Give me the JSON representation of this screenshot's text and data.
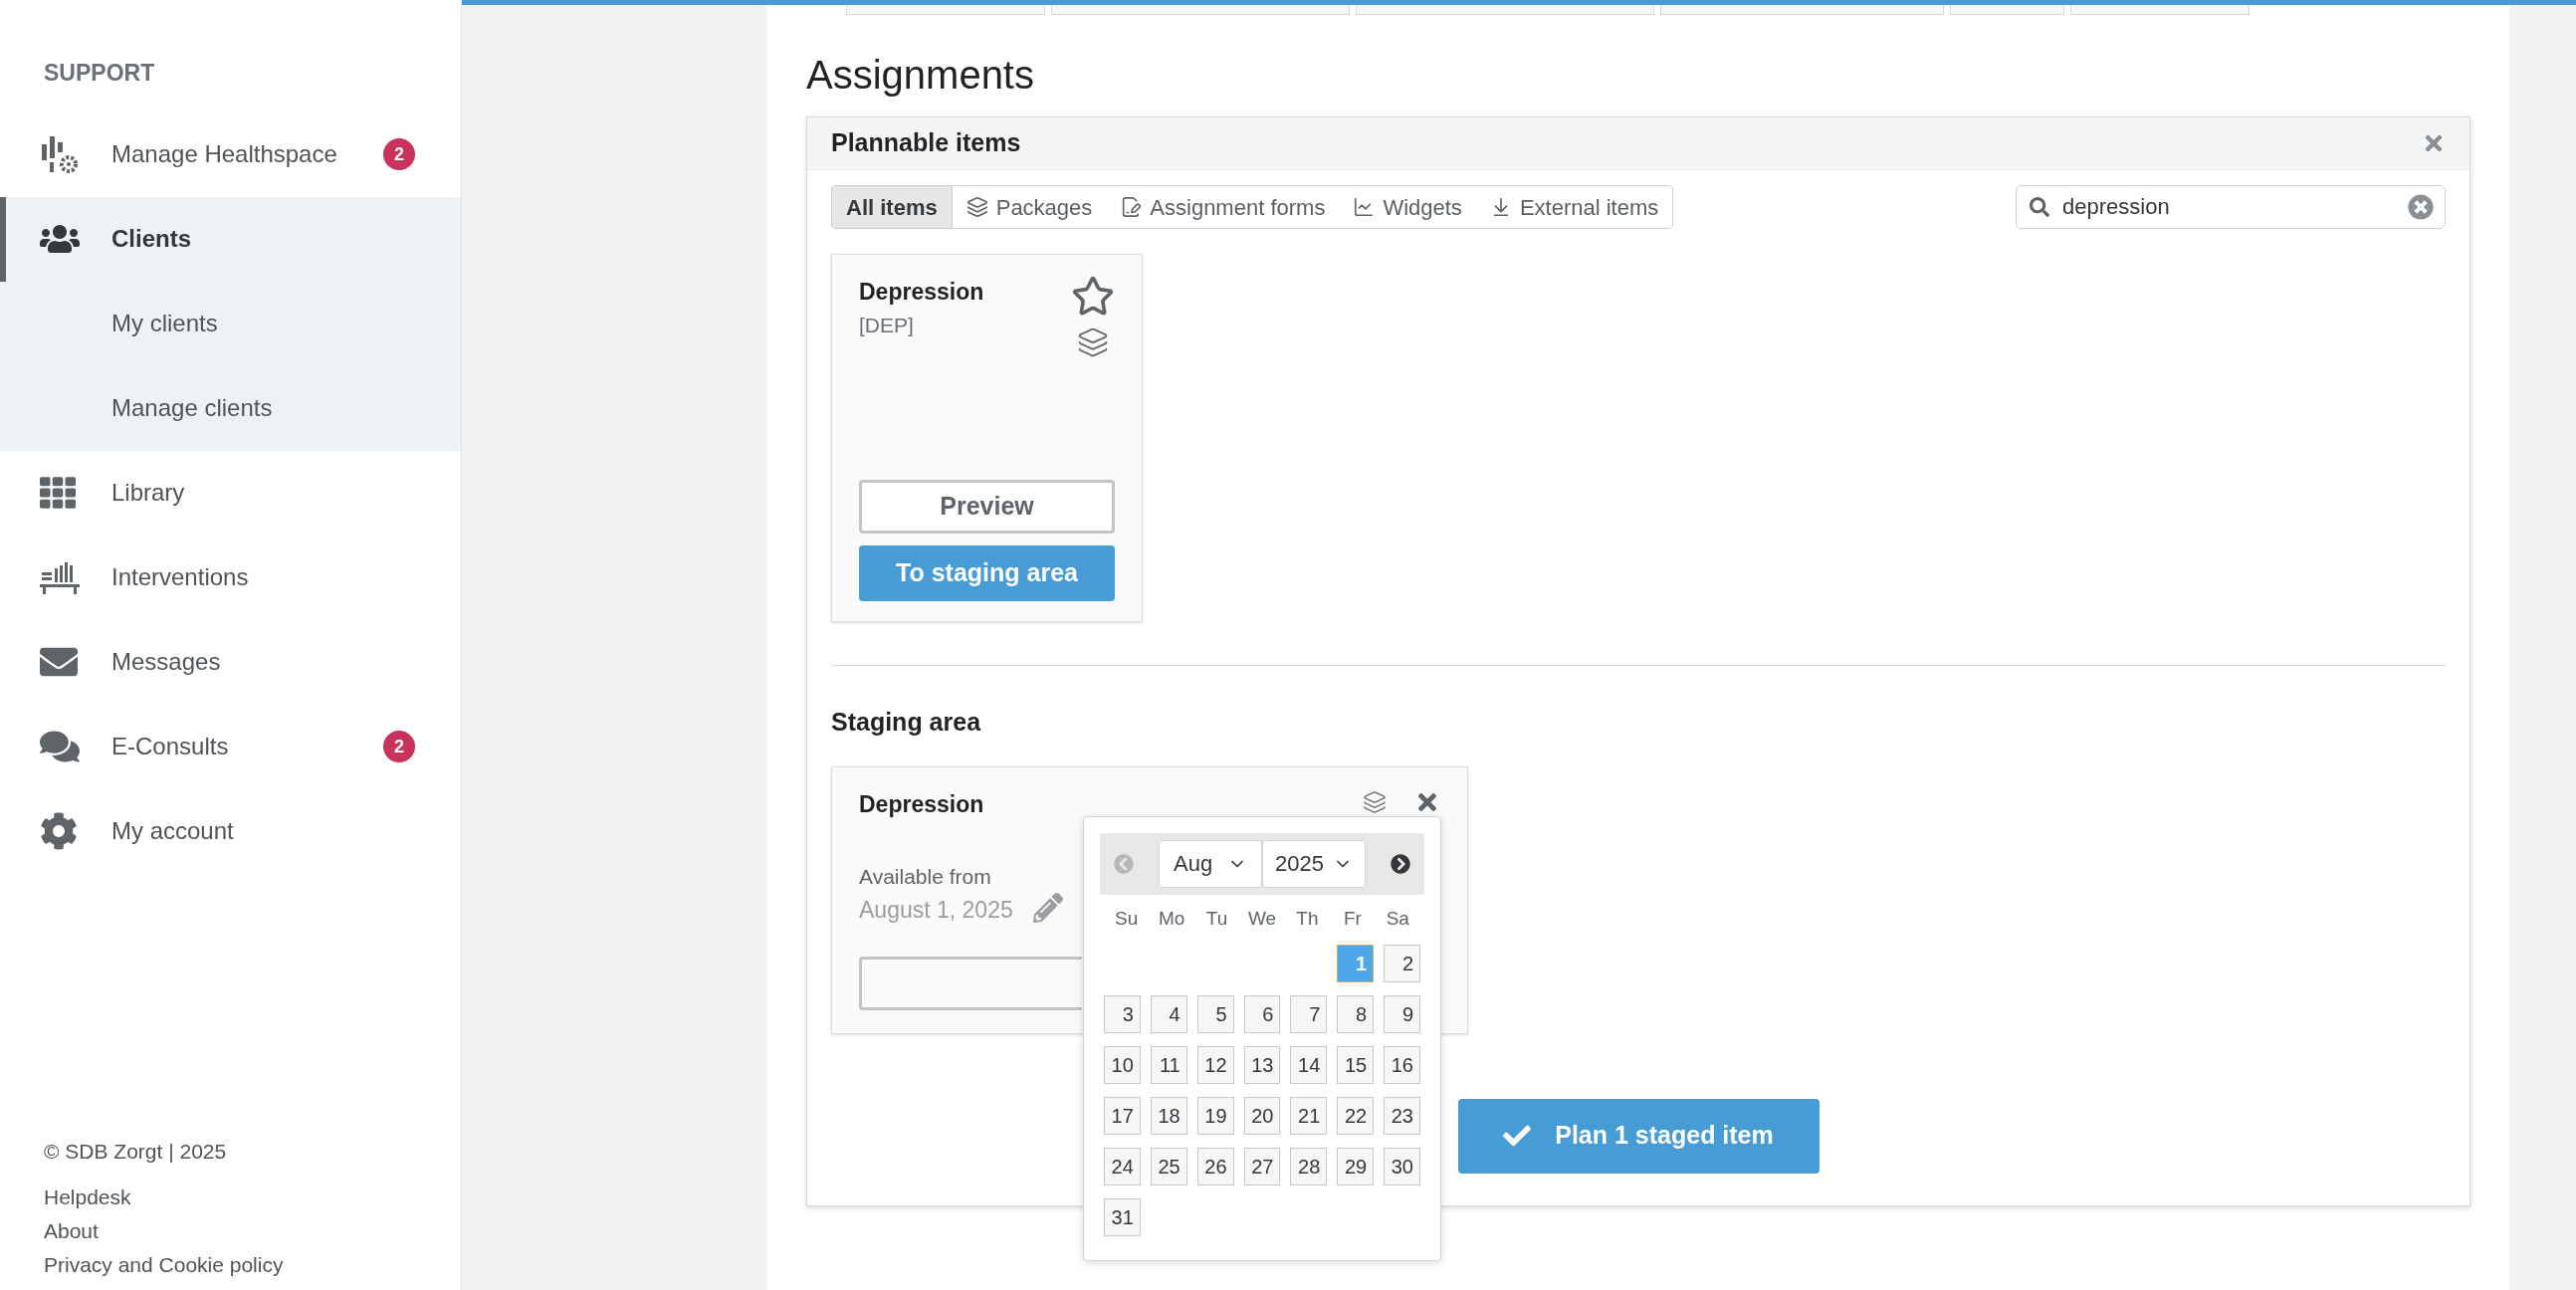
{
  "sidebar": {
    "section_title": "SUPPORT",
    "items": [
      {
        "label": "Manage Healthspace",
        "badge": "2",
        "selected": false
      },
      {
        "label": "Clients",
        "selected": true,
        "expanded": true,
        "children": [
          {
            "label": "My clients"
          },
          {
            "label": "Manage clients"
          }
        ]
      },
      {
        "label": "Library",
        "selected": false
      },
      {
        "label": "Interventions",
        "selected": false
      },
      {
        "label": "Messages",
        "selected": false
      },
      {
        "label": "E-Consults",
        "badge": "2",
        "selected": false
      },
      {
        "label": "My account",
        "selected": false
      }
    ],
    "footer": [
      "© SDB Zorgt | 2025",
      "Helpdesk",
      "About",
      "Privacy and Cookie policy"
    ]
  },
  "page_title": "Assignments",
  "plannable_panel": {
    "title": "Plannable items",
    "filter_tabs": [
      {
        "label": "All items",
        "selected": true
      },
      {
        "label": "Packages",
        "selected": false
      },
      {
        "label": "Assignment forms",
        "selected": false
      },
      {
        "label": "Widgets",
        "selected": false
      },
      {
        "label": "External items",
        "selected": false
      }
    ],
    "search": {
      "value": "depression"
    },
    "items": [
      {
        "title": "Depression",
        "code": "[DEP]",
        "starred": false,
        "preview_button": "Preview",
        "stage_button": "To staging area"
      }
    ]
  },
  "staging_area": {
    "title": "Staging area",
    "items": [
      {
        "title": "Depression",
        "available_label": "Available from",
        "available_date": "August 1, 2025"
      }
    ]
  },
  "datepicker": {
    "month": "Aug",
    "year": "2025",
    "weekdays": [
      "Su",
      "Mo",
      "Tu",
      "We",
      "Th",
      "Fr",
      "Sa"
    ],
    "weeks": [
      {
        "kind": "first",
        "days": [
          {
            "label": "1",
            "selected": true
          },
          {
            "label": "2",
            "selected": false
          }
        ]
      },
      {
        "kind": "full",
        "days": [
          {
            "label": "3",
            "selected": false
          },
          {
            "label": "4",
            "selected": false
          },
          {
            "label": "5",
            "selected": false
          },
          {
            "label": "6",
            "selected": false
          },
          {
            "label": "7",
            "selected": false
          },
          {
            "label": "8",
            "selected": false
          },
          {
            "label": "9",
            "selected": false
          }
        ]
      },
      {
        "kind": "full",
        "days": [
          {
            "label": "10",
            "selected": false
          },
          {
            "label": "11",
            "selected": false
          },
          {
            "label": "12",
            "selected": false
          },
          {
            "label": "13",
            "selected": false
          },
          {
            "label": "14",
            "selected": false
          },
          {
            "label": "15",
            "selected": false
          },
          {
            "label": "16",
            "selected": false
          }
        ]
      },
      {
        "kind": "full",
        "days": [
          {
            "label": "17",
            "selected": false
          },
          {
            "label": "18",
            "selected": false
          },
          {
            "label": "19",
            "selected": false
          },
          {
            "label": "20",
            "selected": false
          },
          {
            "label": "21",
            "selected": false
          },
          {
            "label": "22",
            "selected": false
          },
          {
            "label": "23",
            "selected": false
          }
        ]
      },
      {
        "kind": "full",
        "days": [
          {
            "label": "24",
            "selected": false
          },
          {
            "label": "25",
            "selected": false
          },
          {
            "label": "26",
            "selected": false
          },
          {
            "label": "27",
            "selected": false
          },
          {
            "label": "28",
            "selected": false
          },
          {
            "label": "29",
            "selected": false
          },
          {
            "label": "30",
            "selected": false
          }
        ]
      },
      {
        "kind": "last",
        "days": [
          {
            "label": "31",
            "selected": false
          }
        ]
      }
    ]
  },
  "plan_button": "Plan 1 staged item"
}
